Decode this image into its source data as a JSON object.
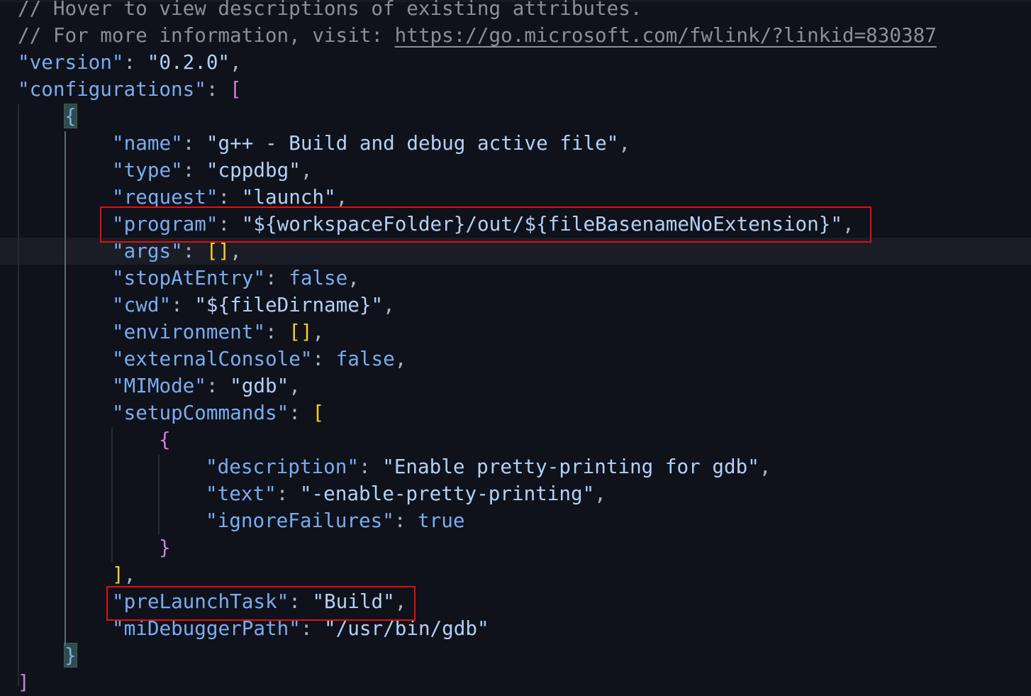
{
  "editor": {
    "lines": [
      {
        "indent": 0,
        "kind": "comment",
        "text": "// Hover to view descriptions of existing attributes."
      },
      {
        "indent": 0,
        "kind": "comment-link",
        "text": "// For more information, visit: ",
        "link": "https://go.microsoft.com/fwlink/?linkid=830387"
      },
      {
        "indent": 0,
        "kind": "kv",
        "key": "\"version\"",
        "value": "\"0.2.0\"",
        "trail": ","
      },
      {
        "indent": 0,
        "kind": "kv-open",
        "key": "\"configurations\"",
        "open": "["
      },
      {
        "indent": 1,
        "kind": "brace",
        "text": "{"
      },
      {
        "indent": 2,
        "kind": "kv",
        "key": "\"name\"",
        "value": "\"g++ - Build and debug active file\"",
        "trail": ","
      },
      {
        "indent": 2,
        "kind": "kv",
        "key": "\"type\"",
        "value": "\"cppdbg\"",
        "trail": ","
      },
      {
        "indent": 2,
        "kind": "kv",
        "key": "\"request\"",
        "value": "\"launch\"",
        "trail": ","
      },
      {
        "indent": 2,
        "kind": "kv",
        "key": "\"program\"",
        "value": "\"${workspaceFolder}/out/${fileBasenameNoExtension}\"",
        "trail": ","
      },
      {
        "indent": 2,
        "kind": "kv-arr",
        "key": "\"args\"",
        "value": "[]",
        "trail": ","
      },
      {
        "indent": 2,
        "kind": "kv-kw",
        "key": "\"stopAtEntry\"",
        "value": "false",
        "trail": ","
      },
      {
        "indent": 2,
        "kind": "kv",
        "key": "\"cwd\"",
        "value": "\"${fileDirname}\"",
        "trail": ","
      },
      {
        "indent": 2,
        "kind": "kv-arr",
        "key": "\"environment\"",
        "value": "[]",
        "trail": ","
      },
      {
        "indent": 2,
        "kind": "kv-kw",
        "key": "\"externalConsole\"",
        "value": "false",
        "trail": ","
      },
      {
        "indent": 2,
        "kind": "kv",
        "key": "\"MIMode\"",
        "value": "\"gdb\"",
        "trail": ","
      },
      {
        "indent": 2,
        "kind": "kv-open",
        "key": "\"setupCommands\"",
        "open": "["
      },
      {
        "indent": 3,
        "kind": "brace-m",
        "text": "{"
      },
      {
        "indent": 4,
        "kind": "kv",
        "key": "\"description\"",
        "value": "\"Enable pretty-printing for gdb\"",
        "trail": ","
      },
      {
        "indent": 4,
        "kind": "kv",
        "key": "\"text\"",
        "value": "\"-enable-pretty-printing\"",
        "trail": ","
      },
      {
        "indent": 4,
        "kind": "kv-kw",
        "key": "\"ignoreFailures\"",
        "value": "true",
        "trail": ""
      },
      {
        "indent": 3,
        "kind": "brace-m",
        "text": "}"
      },
      {
        "indent": 2,
        "kind": "close-y",
        "text": "]",
        "trail": ","
      },
      {
        "indent": 2,
        "kind": "kv",
        "key": "\"preLaunchTask\"",
        "value": "\"Build\"",
        "trail": ","
      },
      {
        "indent": 2,
        "kind": "kv",
        "key": "\"miDebuggerPath\"",
        "value": "\"/usr/bin/gdb\"",
        "trail": ""
      },
      {
        "indent": 1,
        "kind": "brace",
        "text": "}"
      },
      {
        "indent": 0,
        "kind": "close-m",
        "text": "]",
        "trail": ""
      }
    ],
    "current_line": 9,
    "matched_brace_lines": [
      4,
      24
    ],
    "highlighted_lines": [
      8,
      22
    ],
    "colon": ": "
  }
}
